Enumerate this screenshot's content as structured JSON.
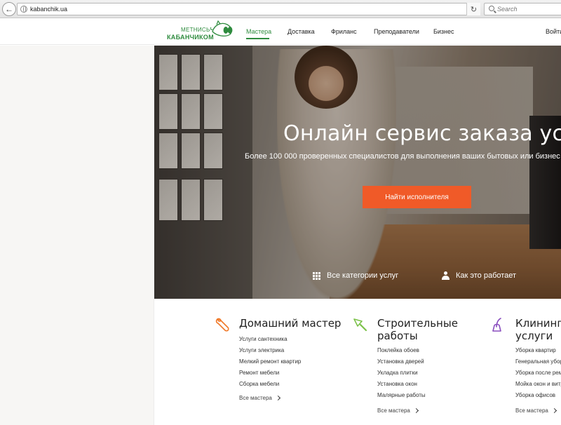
{
  "browser": {
    "url": "kabanchik.ua",
    "search_placeholder": "Search",
    "reload_glyph": "↻",
    "back_glyph": "←"
  },
  "header": {
    "logo_top": "МЕТНИСЬ",
    "logo_bottom": "КАБАНЧИКОМ",
    "nav": [
      "Мастера",
      "Доставка",
      "Фриланс",
      "Преподаватели",
      "Бизнес"
    ],
    "login": "Войти"
  },
  "hero": {
    "title": "Онлайн сервис заказа услуг",
    "subtitle": "Более 100 000 проверенных специалистов для выполнения ваших бытовых или бизнес задач",
    "cta": "Найти исполнителя",
    "link_categories": "Все категории услуг",
    "link_how": "Как это работает"
  },
  "categories": [
    {
      "title": "Домашний мастер",
      "items": [
        "Услуги сантехника",
        "Услуги электрика",
        "Мелкий ремонт квартир",
        "Ремонт мебели",
        "Сборка мебели"
      ],
      "see_all": "Все мастера",
      "icon": "wrench-icon"
    },
    {
      "title": "Строительные работы",
      "items": [
        "Поклейка обоев",
        "Установка дверей",
        "Укладка плитки",
        "Установка окон",
        "Малярные работы"
      ],
      "see_all": "Все мастера",
      "icon": "trowel-icon"
    },
    {
      "title": "Клининговые услуги",
      "items": [
        "Уборка квартир",
        "Генеральная уборка",
        "Уборка после ремонта",
        "Мойка окон и витрин",
        "Уборка офисов"
      ],
      "see_all": "Все мастера",
      "icon": "vacuum-icon"
    }
  ],
  "colors": {
    "brand_green": "#2e8b3e",
    "cta_orange": "#f05a28",
    "wrench_orange": "#f07a2a",
    "trowel_green": "#7cc24a",
    "vacuum_purple": "#8a4fbf"
  }
}
